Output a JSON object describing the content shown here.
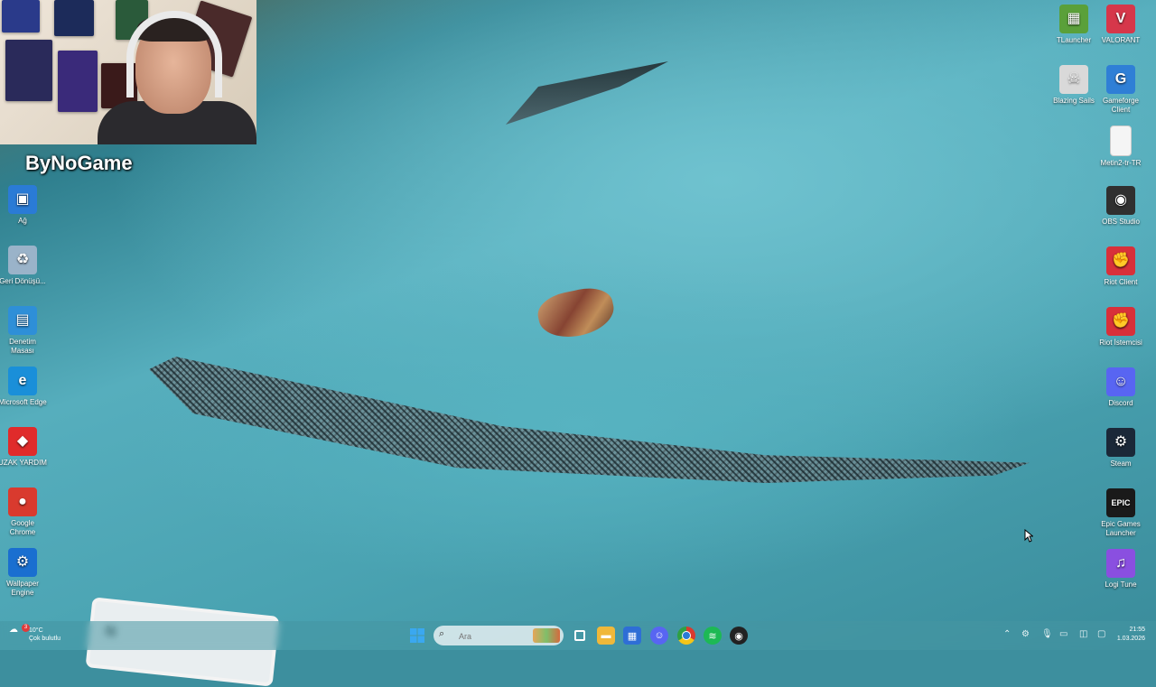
{
  "brand_overlay": "ByNoGame",
  "desktop_left": [
    {
      "name": "network",
      "label": "Ağ",
      "color": "#2a7bd6",
      "glyph": "▣"
    },
    {
      "name": "recycle-bin",
      "label": "Geri Dönüşü...",
      "color": "#9ab3c9",
      "glyph": "♻"
    },
    {
      "name": "control-panel",
      "label": "Denetim Masası",
      "color": "#2e8fd8",
      "glyph": "▤"
    },
    {
      "name": "microsoft-edge",
      "label": "Microsoft Edge",
      "color": "#1a8fd9",
      "glyph": "e"
    },
    {
      "name": "uzak-yardim",
      "label": "UZAK YARDIM",
      "color": "#e02b2b",
      "glyph": "◆"
    },
    {
      "name": "google-chrome",
      "label": "Google Chrome",
      "color": "#d93a2e",
      "glyph": "●"
    },
    {
      "name": "wallpaper-engine",
      "label": "Wallpaper Engine",
      "color": "#1a6fd0",
      "glyph": "⚙"
    }
  ],
  "desktop_right": [
    {
      "name": "tlauncher",
      "label": "TLauncher",
      "color": "#5aa03a",
      "glyph": "▦"
    },
    {
      "name": "valorant",
      "label": "VALORANT",
      "color": "#d6374a",
      "glyph": "V"
    },
    {
      "name": "blazing-sails",
      "label": "Blazing Sails",
      "color": "#d9d9d9",
      "glyph": "☠"
    },
    {
      "name": "gameforge-client",
      "label": "Gameforge Client",
      "color": "#2f7fd6",
      "glyph": "G"
    },
    {
      "name": "metin2",
      "label": "Metin2-tr-TR",
      "color": "#f5f5f5",
      "glyph": ""
    },
    {
      "name": "obs-studio",
      "label": "OBS Studio",
      "color": "#303030",
      "glyph": "◉"
    },
    {
      "name": "riot-client",
      "label": "Riot Client",
      "color": "#d8303a",
      "glyph": "✊"
    },
    {
      "name": "riot-istemcisi",
      "label": "Riot İstemcisi",
      "color": "#d8303a",
      "glyph": "✊"
    },
    {
      "name": "discord",
      "label": "Discord",
      "color": "#5865f2",
      "glyph": "☺"
    },
    {
      "name": "steam",
      "label": "Steam",
      "color": "#1b2838",
      "glyph": "⚙"
    },
    {
      "name": "epic-games-launcher",
      "label": "Epic Games Launcher",
      "color": "#1a1a1a",
      "glyph": "EPIC"
    },
    {
      "name": "logi-tune",
      "label": "Logi Tune",
      "color": "#8a4fe0",
      "glyph": "♫"
    }
  ],
  "taskbar": {
    "search_placeholder": "Ara",
    "weather_temp": "10°C",
    "weather_desc": "Çok bulutlu",
    "weather_badge": "3",
    "clock_time": "21:55",
    "clock_date": "1.03.2026"
  },
  "wallpaper": {
    "plate_text": "N"
  }
}
